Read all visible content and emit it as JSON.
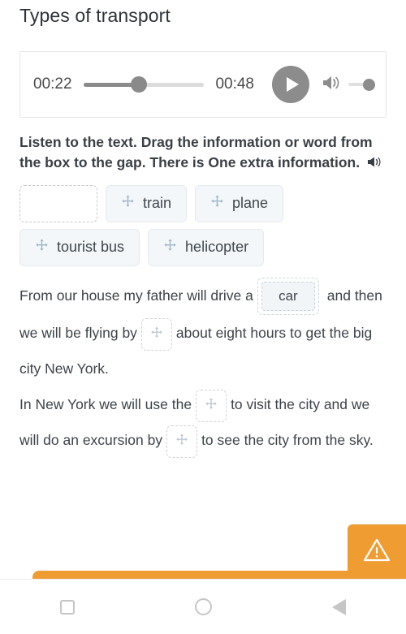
{
  "window": {
    "tab_left": "",
    "tab_right": ""
  },
  "page": {
    "title": "Types of transport"
  },
  "player": {
    "current_time": "00:22",
    "total_time": "00:48",
    "progress_percent": 46,
    "play_label": "play-button",
    "volume_level": 100,
    "icons": {
      "play": "play-icon",
      "volume": "volume-icon"
    }
  },
  "instruction": {
    "text": "Listen to the text. Drag the information or word from the box to the gap. There is One extra information.",
    "speaker_icon": "speaker-icon"
  },
  "bank": {
    "items": [
      {
        "label": "",
        "empty": true,
        "icon": ""
      },
      {
        "label": "train",
        "empty": false,
        "icon": "move-icon"
      },
      {
        "label": "plane",
        "empty": false,
        "icon": "move-icon"
      },
      {
        "label": "tourist bus",
        "empty": false,
        "icon": "move-icon"
      },
      {
        "label": "helicopter",
        "empty": false,
        "icon": "move-icon"
      }
    ]
  },
  "passage": {
    "p1_before": "From our house my father will drive a",
    "gap1_value": "car",
    "p1_after": " and then we will be flying by",
    "p1_tail": "about eight hours to get the big city New York.",
    "p2_before": "In New York we will use the",
    "p2_middle": "to visit the city and we will do an excursion by",
    "p2_tail": "to see the city from the sky.",
    "gap_icon": "move-diamond-icon"
  },
  "alert": {
    "icon": "warning-triangle-icon",
    "color": "#ef9c32"
  },
  "navbar": {
    "recents": "recents-button",
    "home": "home-button",
    "back": "back-button"
  },
  "colors": {
    "accent_orange": "#ef9c32",
    "chip_bg": "#f3f7fa",
    "tab_blue_gray": "#a7bdc6",
    "player_gray": "#8c8c8c"
  }
}
